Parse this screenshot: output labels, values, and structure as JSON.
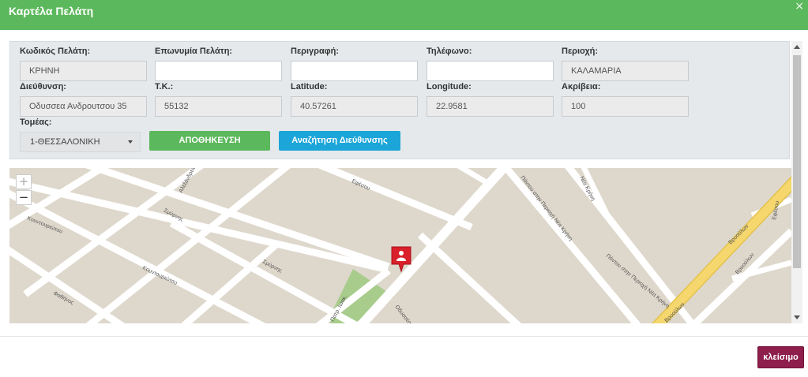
{
  "dialog": {
    "title": "Καρτέλα Πελάτη",
    "close_icon": "×"
  },
  "form": {
    "customer_code": {
      "label": "Κωδικός Πελάτη:",
      "value": "ΚΡΗΝΗ"
    },
    "customer_name": {
      "label": "Επωνυμία Πελάτη:",
      "value": ""
    },
    "description": {
      "label": "Περιγραφή:",
      "value": ""
    },
    "phone": {
      "label": "Τηλέφωνο:",
      "value": ""
    },
    "area": {
      "label": "Περιοχή:",
      "value": "ΚΑΛΑΜΑΡΙΑ"
    },
    "address": {
      "label": "Διεύθυνση:",
      "value": "Οδυσσεα Ανδρουτσου 35"
    },
    "postal_code": {
      "label": "Τ.Κ.:",
      "value": "55132"
    },
    "latitude": {
      "label": "Latitude:",
      "value": "40.57261"
    },
    "longitude": {
      "label": "Longitude:",
      "value": "22.9581"
    },
    "accuracy": {
      "label": "Ακρίβεια:",
      "value": "100"
    },
    "sector": {
      "label": "Τομέας:",
      "value": "1-ΘΕΣΣΑΛΟΝΙΚΗ"
    }
  },
  "buttons": {
    "save": "ΑΠΟΘΗΚΕΥΣΗ",
    "search_address": "Αναζήτηση Διεύθυνσης",
    "close": "κλείσιμο"
  },
  "map": {
    "zoom_in": "+",
    "zoom_out": "−",
    "marker_icon": "person-marker-icon",
    "streets": {
      "kountouriotou_1": "Κουντουριώτου",
      "kountouriotou_2": "Κουντουριώτου",
      "smyrnis_1": "Σμύρνης",
      "smyrnis_2": "Σμύρνης",
      "ethnikis": "Εφέσου",
      "alexandreias": "Αλεξάνδρειας",
      "pontou_1": "Πόντου στην Περιοχή Νέα Κρήνη",
      "pontou_2": "Πόντου στην Περιοχή Νέα Κρήνη",
      "nea_krini": "Νέα Κρήνη",
      "vrioulon_1": "Βρυούλων",
      "vrioulon_2": "Βρυούλων",
      "vrioulon_3": "Βρυούλων",
      "patr_ioakeim": "Πατρ. Ιωακ.",
      "odyssea": "Οδυσσέα Ανδρ.",
      "fathunos": "Φαθήνος",
      "efesou": "Εφέσου"
    }
  },
  "colors": {
    "header": "#5cb85c",
    "save_button": "#5cb85c",
    "search_button": "#1ba5d8",
    "close_button": "#8e1e4c",
    "map_bg": "#ded8cc",
    "road": "#ffffff",
    "highway": "#f5d76e",
    "park": "#a8cc8c",
    "marker": "#d9202a"
  }
}
